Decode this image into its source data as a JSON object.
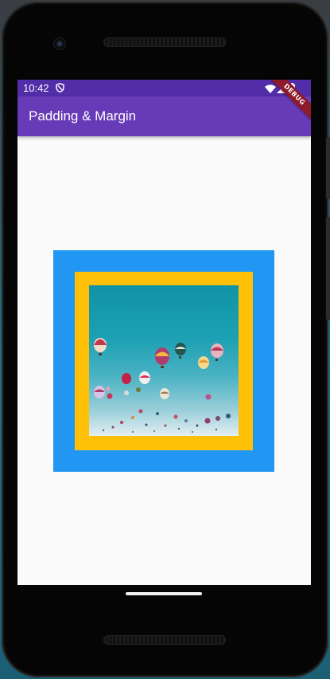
{
  "status_bar": {
    "time": "10:42",
    "icons": [
      "shield-icon",
      "wifi-icon",
      "signal-icon",
      "battery-icon"
    ]
  },
  "app_bar": {
    "title": "Padding & Margin",
    "debug_banner": "DEBUG"
  },
  "content": {
    "outer_container_color": "#2196f3",
    "padding_container_color": "#ffc107",
    "image_subject": "hot-air-balloons-photo"
  },
  "colors": {
    "status_bar": "#512da8",
    "app_bar": "#673ab7",
    "screen_background": "#fafafa"
  }
}
